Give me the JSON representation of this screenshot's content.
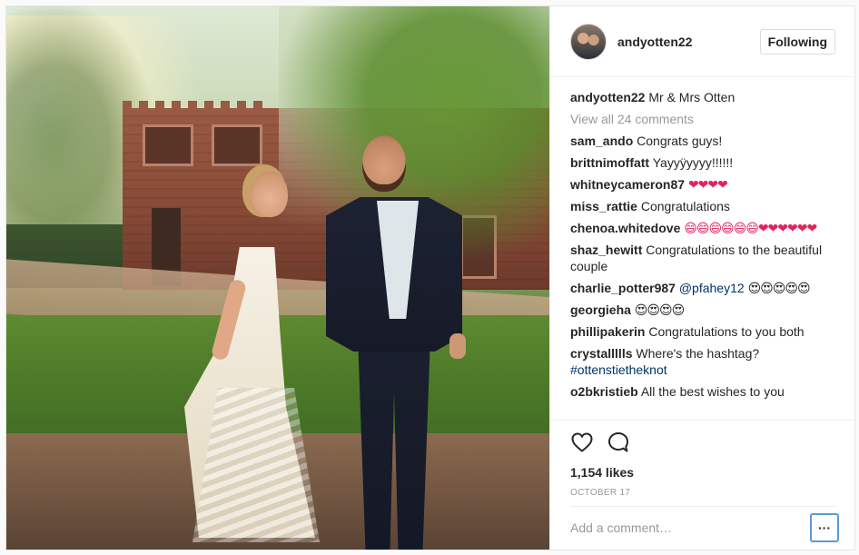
{
  "post": {
    "username": "andyotten22",
    "follow_label": "Following",
    "caption_user": "andyotten22",
    "caption_text": "Mr & Mrs Otten",
    "view_all": "View all 24 comments",
    "comments": [
      {
        "user": "sam_ando",
        "text": "Congrats guys!"
      },
      {
        "user": "brittnimoffatt",
        "text": "Yayyÿyyyy!!!!!!"
      },
      {
        "user": "whitneycameron87",
        "text": "❤❤❤❤"
      },
      {
        "user": "miss_rattie",
        "text": "Congratulations"
      },
      {
        "user": "chenoa.whitedove",
        "text": "😄😄😄😄😄😄❤❤❤❤❤❤"
      },
      {
        "user": "shaz_hewitt",
        "text": "Congratulations to the beautiful couple"
      },
      {
        "user": "charlie_potter987",
        "mention": "@pfahey12",
        "text": "😍😍😍😍😍"
      },
      {
        "user": "georgieha",
        "text": "😍😍😍😍"
      },
      {
        "user": "phillipakerin",
        "text": "Congratulations to you both"
      },
      {
        "user": "crystallllls",
        "text": "Where's the hashtag?",
        "hashtag": "#ottenstietheknot"
      },
      {
        "user": "o2bkristieb",
        "text": "All the best wishes to you"
      }
    ],
    "likes": "1,154 likes",
    "date": "OCTOBER 17",
    "comment_placeholder": "Add a comment…",
    "more_label": "···",
    "icons": {
      "like": "heart-icon",
      "comment": "comment-icon",
      "more": "more-options-icon"
    },
    "colors": {
      "link": "#003569",
      "muted": "#999999",
      "heart": "#e0245e",
      "focus": "#5a9bd4"
    }
  }
}
